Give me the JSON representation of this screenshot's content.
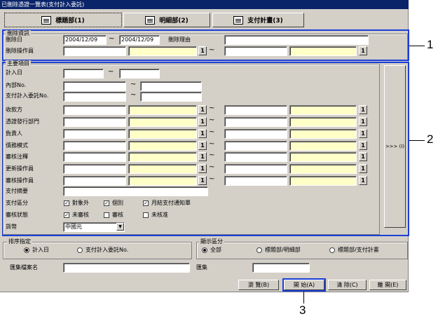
{
  "window_title": "已刪除憑證一覽表(支付計入委託)",
  "tabs": [
    {
      "label": "標題部(1)"
    },
    {
      "label": "明細部(2)"
    },
    {
      "label": "支付計畫(3)"
    }
  ],
  "deletion_info": {
    "group_label": "刪除資訊",
    "delete_date_label": "刪除日",
    "delete_date_from": "2004/12/09",
    "delete_date_to": "2004/12/09",
    "reason_label": "刪除理由",
    "operator_label": "刪除操作員"
  },
  "main_items": {
    "group_label": "主要項目",
    "rows": {
      "entry_date": "計入日",
      "internal_no": "內部No.",
      "pay_request_no": "支付計入委託No.",
      "payee": "收款方",
      "voucher_dept": "憑證發行部門",
      "responsible": "負責人",
      "debt_type": "債務模式",
      "audit_note": "審核注釋",
      "updater": "更新操作員",
      "auditor": "審核操作員",
      "pay_summary": "支付摘要",
      "pay_category": "支付區分",
      "audit_status": "審核狀態",
      "currency": "貨幣"
    },
    "pay_category_options": [
      {
        "label": "對象外",
        "checked": true
      },
      {
        "label": "個別",
        "checked": true
      },
      {
        "label": "月結支付通知單",
        "checked": true
      }
    ],
    "audit_status_options": [
      {
        "label": "未審核",
        "checked": true
      },
      {
        "label": "審核",
        "checked": false
      },
      {
        "label": "未核准",
        "checked": false
      }
    ],
    "currency_value": "中國元",
    "more_button": ">>> (I)"
  },
  "sort": {
    "group_label": "排序指定",
    "options": [
      {
        "label": "計入日",
        "selected": true
      },
      {
        "label": "支付計入委託No.",
        "selected": false
      }
    ]
  },
  "display": {
    "group_label": "顯示區分",
    "options": [
      {
        "label": "全部",
        "selected": true
      },
      {
        "label": "標題部/明細部",
        "selected": false
      },
      {
        "label": "標題部/支付計畫",
        "selected": false
      }
    ]
  },
  "file_name_label": "匯集檔案名",
  "collection_label": "匯集",
  "buttons": {
    "browse": "瀏 覽(B)",
    "start": "開 始(A)",
    "clear": "清 除(C)",
    "close": "離 開(E)"
  },
  "lookup_label": "1",
  "tilde": "~",
  "callouts": [
    "1",
    "2",
    "3"
  ]
}
